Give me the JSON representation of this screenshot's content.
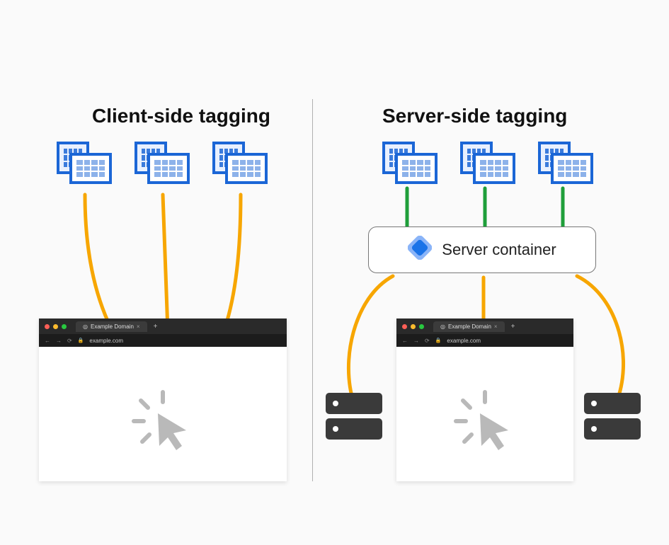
{
  "left": {
    "title": "Client-side tagging",
    "browser": {
      "tab_label": "Example Domain",
      "url": "example.com"
    }
  },
  "right": {
    "title": "Server-side tagging",
    "server_container_label": "Server container",
    "browser": {
      "tab_label": "Example Domain",
      "url": "example.com"
    }
  },
  "colors": {
    "arrow_client": "#f7a600",
    "arrow_server": "#1f9e3a",
    "building_stroke": "#1b66d6"
  }
}
